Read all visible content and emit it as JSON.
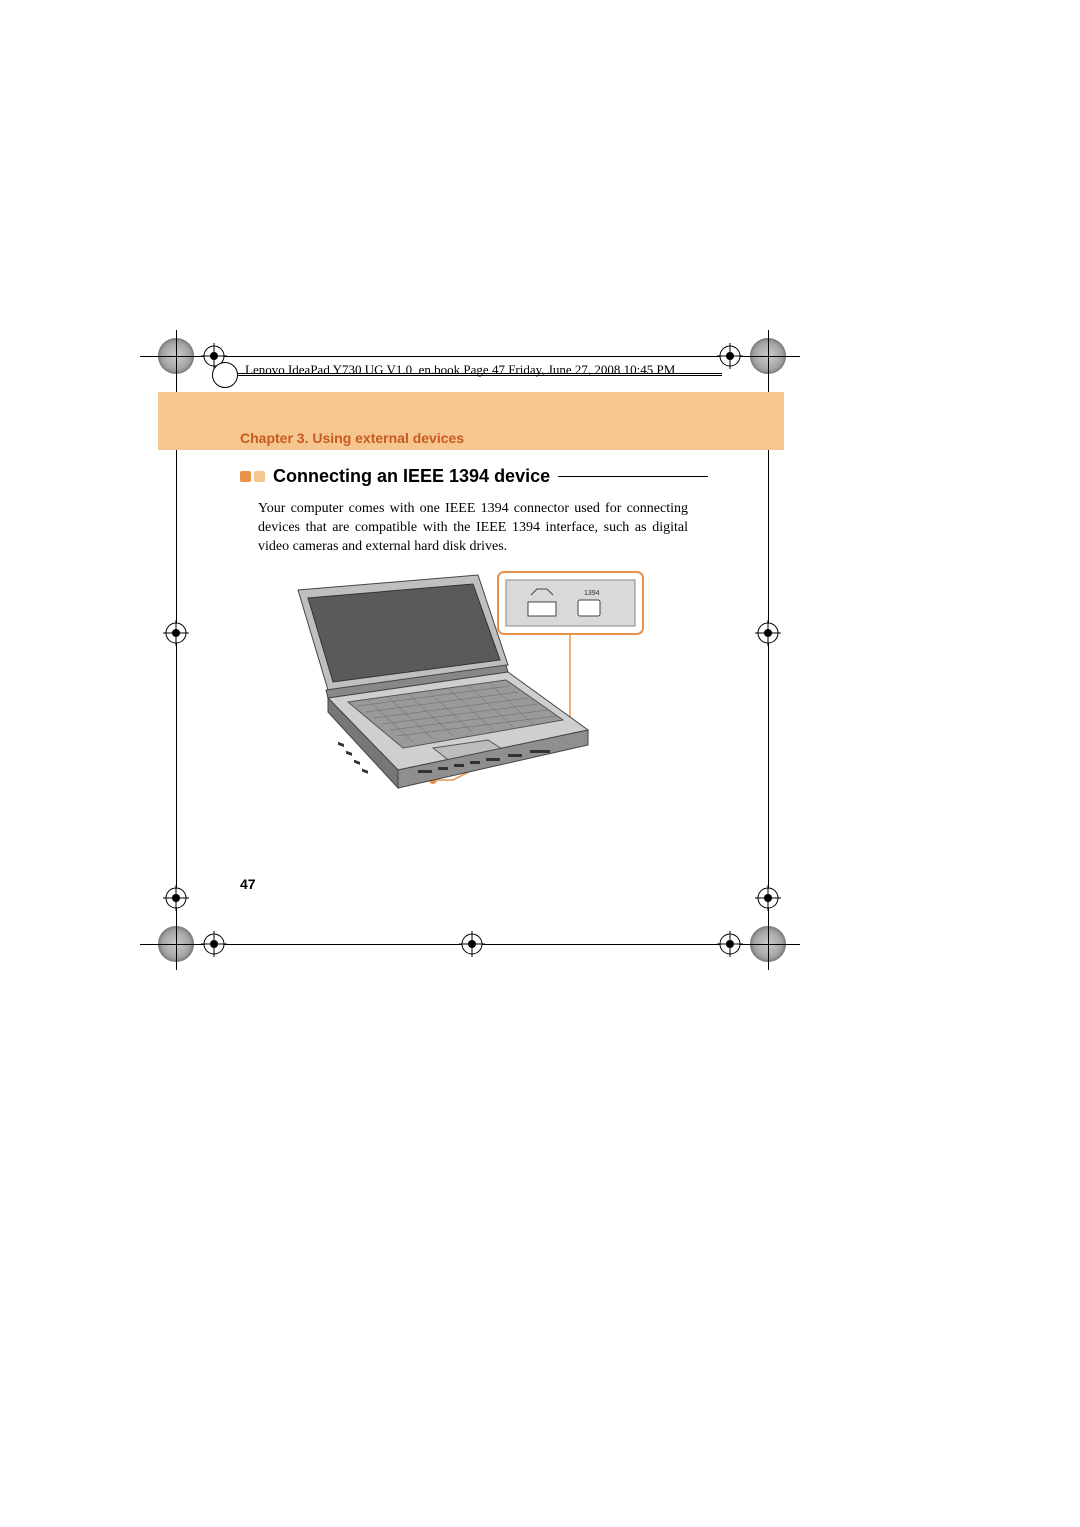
{
  "header": {
    "book_info": "Lenovo IdeaPad Y730 UG V1.0_en.book  Page 47  Friday, June 27, 2008  10:45 PM"
  },
  "chapter": {
    "title": "Chapter 3. Using external devices"
  },
  "section": {
    "heading": "Connecting an IEEE 1394 device",
    "body": "Your computer comes with one IEEE 1394 connector used for connecting devices that are compatible with the IEEE 1394 interface, such as digital video cameras and external hard disk drives."
  },
  "page_number": "47",
  "illustration": {
    "alt": "Laptop with callout showing IEEE 1394 port detail",
    "callout_label": "1394"
  },
  "colors": {
    "accent_orange": "#e8914a",
    "banner": "#f5c690",
    "chapter_text": "#c85a1e"
  }
}
